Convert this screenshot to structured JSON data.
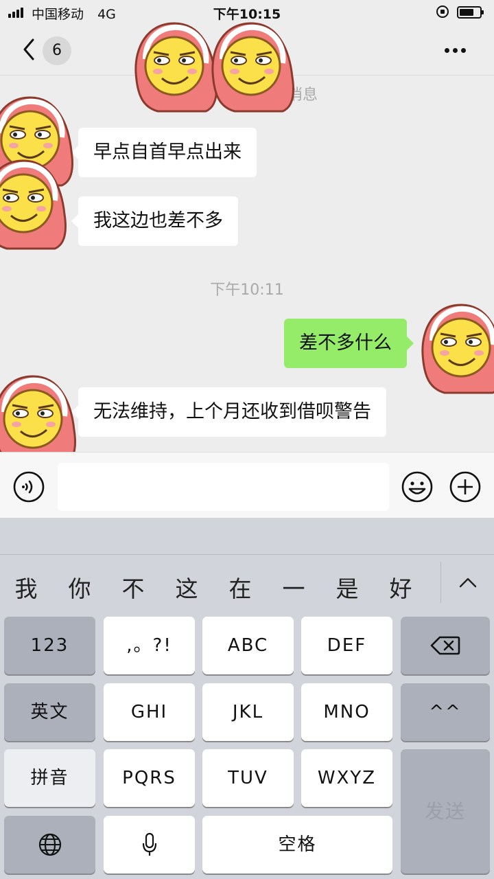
{
  "status_bar": {
    "carrier": "中国移动",
    "network": "4G",
    "time": "下午10:15"
  },
  "nav": {
    "unread_count": "6"
  },
  "chat": {
    "system_message_partial": "条消息",
    "timestamp": "下午10:11",
    "messages": [
      {
        "side": "in",
        "text": "早点自首早点出来"
      },
      {
        "side": "in",
        "text": "我这边也差不多"
      },
      {
        "side": "out",
        "text": "差不多什么"
      },
      {
        "side": "in",
        "text": "无法维持，上个月还收到借呗警告"
      }
    ]
  },
  "input": {
    "value": "",
    "placeholder": ""
  },
  "keyboard": {
    "candidates": [
      "我",
      "你",
      "不",
      "这",
      "在",
      "一",
      "是",
      "好"
    ],
    "keys": {
      "num": "123",
      "punct": ",。?!",
      "abc": "ABC",
      "def": "DEF",
      "english": "英文",
      "ghi": "GHI",
      "jkl": "JKL",
      "mno": "MNO",
      "emoticon": "^^",
      "pinyin": "拼音",
      "pqrs": "PQRS",
      "tuv": "TUV",
      "wxyz": "WXYZ",
      "send": "发送",
      "space": "空格"
    }
  },
  "colors": {
    "out_bubble": "#95ec69",
    "in_bubble": "#ffffff",
    "chat_bg": "#ededed"
  }
}
